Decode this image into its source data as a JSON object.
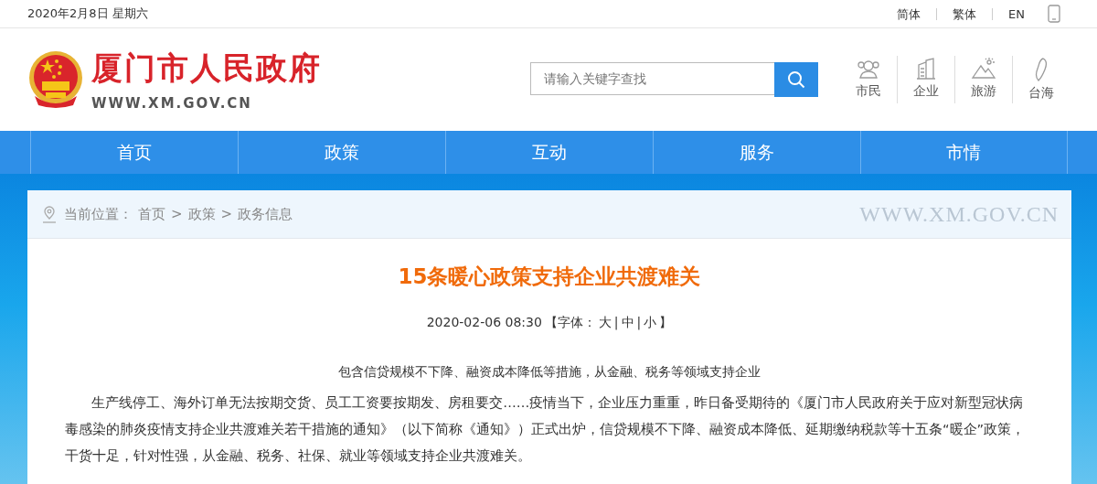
{
  "top_bar": {
    "date": "2020年2月8日 星期六",
    "languages": [
      "简体",
      "繁体",
      "EN"
    ]
  },
  "header": {
    "site_name": "厦门市人民政府",
    "site_url": "WWW.XM.GOV.CN",
    "search": {
      "placeholder": "请输入关键字查找"
    },
    "channels": [
      {
        "label": "市民"
      },
      {
        "label": "企业"
      },
      {
        "label": "旅游"
      },
      {
        "label": "台海"
      }
    ]
  },
  "nav": {
    "items": [
      "首页",
      "政策",
      "互动",
      "服务",
      "市情"
    ]
  },
  "breadcrumb": {
    "label": "当前位置：",
    "separator": ">",
    "items": [
      "首页",
      "政策",
      "政务信息"
    ],
    "banner_text": "WWW.XM.GOV.CN"
  },
  "article": {
    "title": "15条暖心政策支持企业共渡难关",
    "datetime": "2020-02-06 08:30",
    "font_label": "【字体：",
    "font_sizes": [
      "大",
      "中",
      "小"
    ],
    "font_separator": "|",
    "font_close": "】",
    "summary": "包含信贷规模不下降、融资成本降低等措施，从金融、税务等领域支持企业",
    "paragraphs": [
      "生产线停工、海外订单无法按期交货、员工工资要按期发、房租要交……疫情当下，企业压力重重，昨日备受期待的《厦门市人民政府关于应对新型冠状病毒感染的肺炎疫情支持企业共渡难关若干措施的通知》（以下简称《通知》）正式出炉，信贷规模不下降、融资成本降低、延期缴纳税款等十五条“暖企”政策，干货十足，针对性强，从金融、税务、社保、就业等领域支持企业共渡难关。"
    ]
  }
}
